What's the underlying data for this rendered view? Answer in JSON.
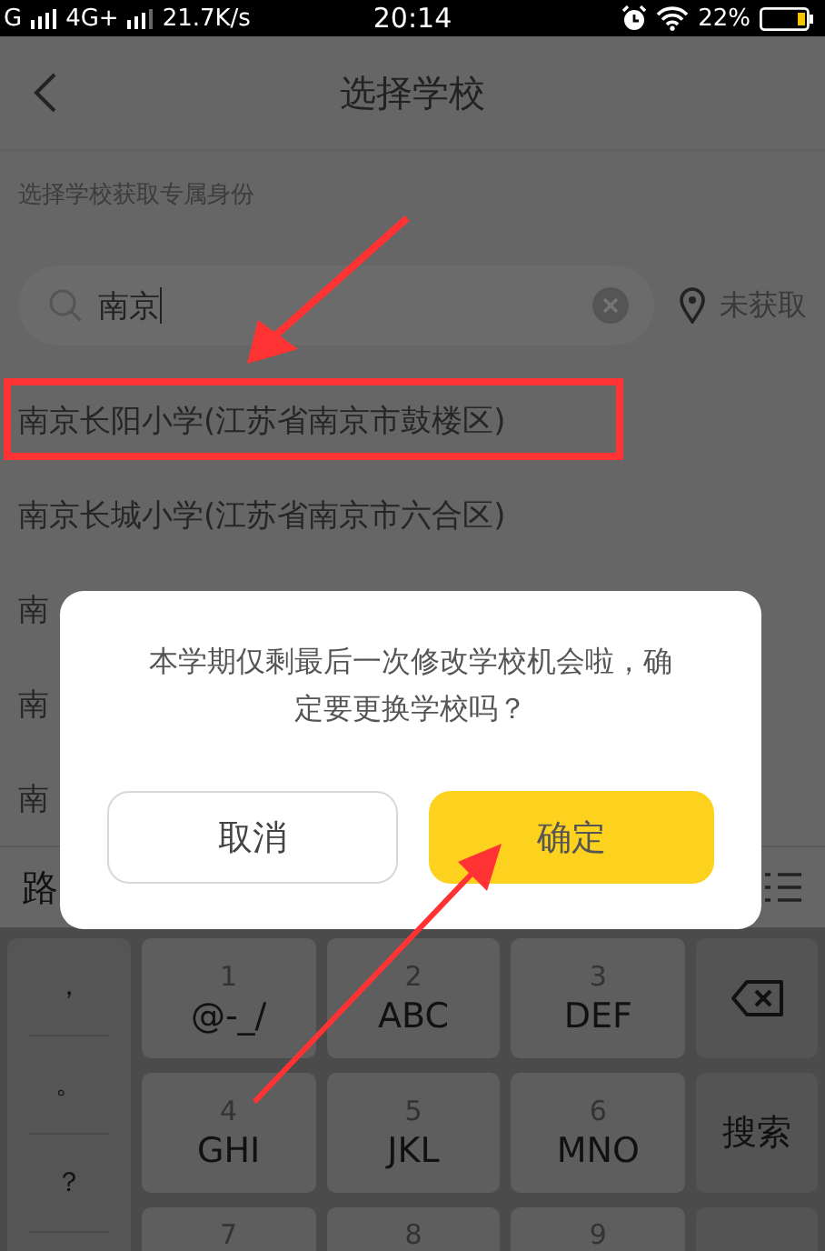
{
  "status_bar": {
    "signal_1": "G",
    "signal_2": "4G+",
    "speed": "21.7K/s",
    "time": "20:14",
    "battery": "22%"
  },
  "header": {
    "title": "选择学校"
  },
  "subtitle": "选择学校获取专属身份",
  "search": {
    "value": "南京"
  },
  "location": "未获取",
  "results": [
    {
      "name": "南京长阳小学(江苏省南京市鼓楼区)",
      "highlighted": true
    },
    {
      "name": "南京长城小学(江苏省南京市六合区)",
      "highlighted": false
    },
    {
      "name": "南",
      "highlighted": false
    },
    {
      "name": "南",
      "highlighted": false
    },
    {
      "name": "南",
      "highlighted": false
    }
  ],
  "candidate_bar": {
    "text": "路"
  },
  "keyboard": {
    "symbols": [
      "，",
      "。",
      "？"
    ],
    "keys": [
      {
        "number": "1",
        "letters": "@-_/"
      },
      {
        "number": "2",
        "letters": "ABC"
      },
      {
        "number": "3",
        "letters": "DEF"
      },
      {
        "number": "4",
        "letters": "GHI"
      },
      {
        "number": "5",
        "letters": "JKL"
      },
      {
        "number": "6",
        "letters": "MNO"
      },
      {
        "number": "7"
      },
      {
        "number": "8"
      },
      {
        "number": "9"
      }
    ],
    "search_key": "搜索"
  },
  "dialog": {
    "message": "本学期仅剩最后一次修改学校机会啦，确定要更换学校吗？",
    "buttons": [
      {
        "label": "取消",
        "kind": "secondary"
      },
      {
        "label": "确定",
        "kind": "primary"
      }
    ]
  }
}
